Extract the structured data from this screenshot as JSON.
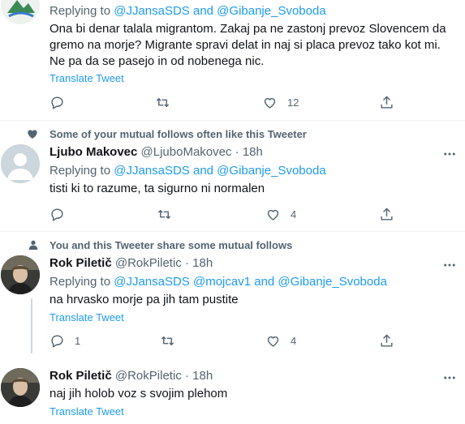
{
  "tweets": [
    {
      "reply_prefix": "Replying to",
      "reply_handles": "@JJansaSDS and @Gibanje_Svoboda",
      "text": "Ona bi denar talala migrantom. Zakaj pa ne zastonj prevoz Slovencem da gremo na morje? Migrante spravi delat in naj si placa prevoz tako kot mi. Ne pa da se pasejo in od nobenega nic.",
      "translate": "Translate Tweet",
      "likes": "12"
    },
    {
      "social_context": "Some of your mutual follows often like this Tweeter",
      "name": "Ljubo Makovec",
      "handle": "@LjuboMakovec",
      "dot": "·",
      "time": "18h",
      "reply_prefix": "Replying to",
      "reply_handles": "@JJansaSDS and @Gibanje_Svoboda",
      "text": "tisti ki to razume, ta sigurno ni normalen",
      "likes": "4"
    },
    {
      "social_context": "You and this Tweeter share some mutual follows",
      "name": "Rok Piletič",
      "handle": "@RokPiletic",
      "dot": "·",
      "time": "18h",
      "reply_prefix": "Replying to",
      "reply_handles": "@JJansaSDS @mojcav1 and @Gibanje_Svoboda",
      "text": "na hrvasko morje pa jih tam pustite",
      "translate": "Translate Tweet",
      "replies": "1",
      "likes": "4"
    },
    {
      "name": "Rok Piletič",
      "handle": "@RokPiletic",
      "dot": "·",
      "time": "18h",
      "text": "naj jih holob voz s svojim plehom",
      "translate": "Translate Tweet"
    }
  ],
  "colors": {
    "link": "#1d9bf0",
    "secondary": "#536471",
    "divider": "#eff3f4",
    "thread": "#cfd9de"
  },
  "icons": [
    "reply-icon",
    "retweet-icon",
    "like-icon",
    "share-icon",
    "more-icon",
    "heart-icon",
    "person-icon"
  ]
}
